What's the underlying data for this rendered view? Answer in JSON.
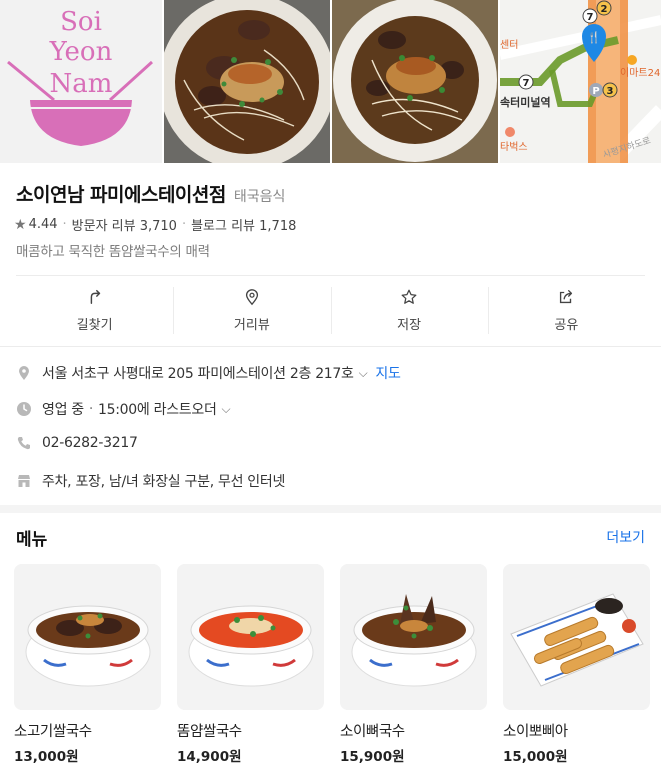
{
  "photos": {
    "logo_text": [
      "Soi",
      "Yeon",
      "Nam"
    ],
    "map": {
      "labels": [
        "센터",
        "이마트24",
        "속터미널역",
        "타벅스",
        "사평지하도로"
      ],
      "exit_numbers": [
        "7",
        "2",
        "7",
        "3"
      ],
      "parking": "P"
    }
  },
  "header": {
    "name": "소이연남 파미에스테이션점",
    "category": "태국음식"
  },
  "stats": {
    "rating": "4.44",
    "visitor_reviews": "방문자 리뷰 3,710",
    "blog_reviews": "블로그 리뷰 1,718"
  },
  "tagline": "매콤하고 묵직한 똠얌쌀국수의 매력",
  "actions": [
    {
      "label": "길찾기",
      "icon": "directions-icon"
    },
    {
      "label": "거리뷰",
      "icon": "street-view-pin-icon"
    },
    {
      "label": "저장",
      "icon": "star-icon"
    },
    {
      "label": "공유",
      "icon": "share-icon"
    }
  ],
  "info": {
    "address": "서울 서초구 사평대로 205 파미에스테이션 2층 217호",
    "map_link": "지도",
    "status": "영업 중",
    "last_order": "15:00에 라스트오더",
    "phone": "02-6282-3217",
    "amenities": "주차, 포장, 남/녀 화장실 구분, 무선 인터넷"
  },
  "menu": {
    "title": "메뉴",
    "more": "더보기",
    "items": [
      {
        "name": "소고기쌀국수",
        "price": "13,000원"
      },
      {
        "name": "똠얌쌀국수",
        "price": "14,900원"
      },
      {
        "name": "소이뼈국수",
        "price": "15,900원"
      },
      {
        "name": "소이뽀삐아",
        "price": "15,000원"
      }
    ]
  },
  "colors": {
    "logo_pink": "#d86fb8",
    "link_blue": "#1a73e8",
    "map_route_green": "#6a9a2a",
    "map_marker_blue": "#1e88e5",
    "map_line_orange": "#f08c3c"
  }
}
